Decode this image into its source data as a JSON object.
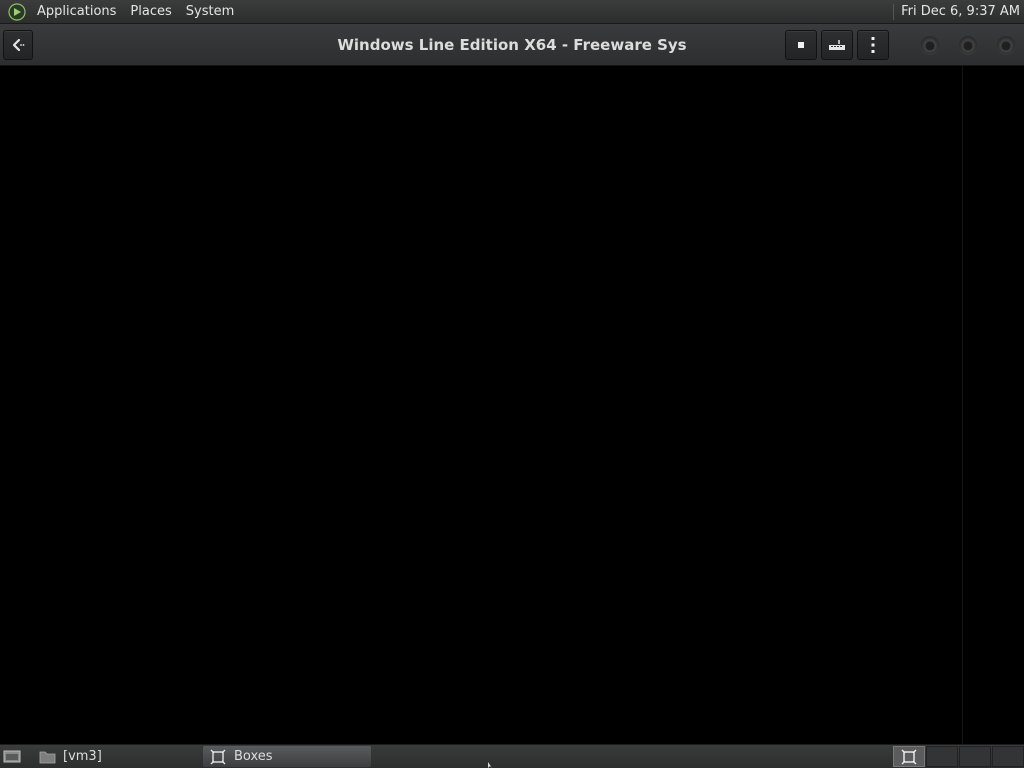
{
  "top_panel": {
    "menus": [
      "Applications",
      "Places",
      "System"
    ],
    "clock": "Fri Dec  6,  9:37 AM",
    "logo_icon": "mate-menu-icon"
  },
  "header": {
    "title": "Windows Line Edition X64 - Freeware Sys",
    "back_icon": "back-arrow-icon",
    "actions": [
      {
        "name": "force-shutdown",
        "icon": "stop-square-icon"
      },
      {
        "name": "send-keys",
        "icon": "keyboard-icon"
      },
      {
        "name": "more-menu",
        "icon": "kebab-menu-icon"
      }
    ],
    "window_controls": [
      "minimize",
      "maximize",
      "close"
    ]
  },
  "bottom_panel": {
    "tasks": [
      {
        "label": "[vm3]",
        "icon": "folder-icon",
        "active": false
      },
      {
        "label": "Boxes",
        "icon": "boxes-icon",
        "active": true
      }
    ],
    "workspaces": 4,
    "active_workspace": 1
  },
  "colors": {
    "panel_bg": "#2f3030",
    "header_bg": "#333435",
    "vm_bg": "#000000",
    "text": "#e4e4e4"
  }
}
